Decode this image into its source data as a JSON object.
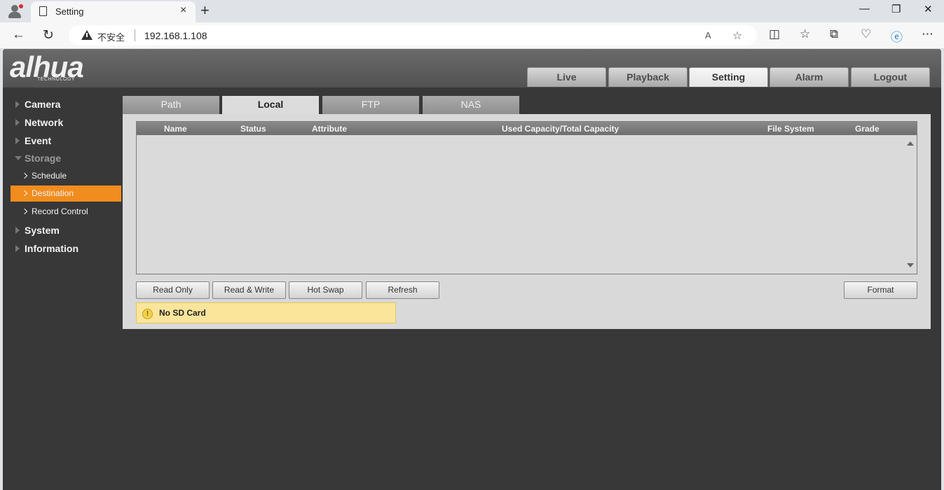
{
  "browser": {
    "tab_title": "Setting",
    "tab_close": "×",
    "new_tab": "+",
    "window_controls": {
      "minimize": "—",
      "maximize": "❐",
      "close": "✕"
    },
    "security_label": "不安全",
    "url": "192.168.1.108",
    "icons": [
      "back-icon",
      "refresh-icon",
      "read-aloud-icon",
      "favorite-icon",
      "split-screen-icon",
      "favorites-icon",
      "collections-icon",
      "performance-icon",
      "edge-bar-icon",
      "more-icon"
    ]
  },
  "app": {
    "logo": "alhua",
    "logo_sub": "TECHNOLOGY",
    "main_tabs": [
      "Live",
      "Playback",
      "Setting",
      "Alarm",
      "Logout"
    ],
    "active_main_tab": "Setting",
    "sidebar": {
      "camera": "Camera",
      "network": "Network",
      "event": "Event",
      "storage": "Storage",
      "schedule": "Schedule",
      "destination": "Destination",
      "record_control": "Record Control",
      "system": "System",
      "information": "Information"
    },
    "active_sidebar_item": "Destination",
    "sub_tabs": [
      "Path",
      "Local",
      "FTP",
      "NAS"
    ],
    "active_sub_tab": "Local",
    "table": {
      "headers": [
        "Name",
        "Status",
        "Attribute",
        "Used Capacity/Total Capacity",
        "File System",
        "Grade"
      ],
      "rows": []
    },
    "buttons": {
      "read_only": "Read Only",
      "read_write": "Read & Write",
      "hot_swap": "Hot Swap",
      "refresh": "Refresh",
      "format": "Format"
    },
    "notice": "No SD Card",
    "accent_color": "#f28c1e"
  }
}
